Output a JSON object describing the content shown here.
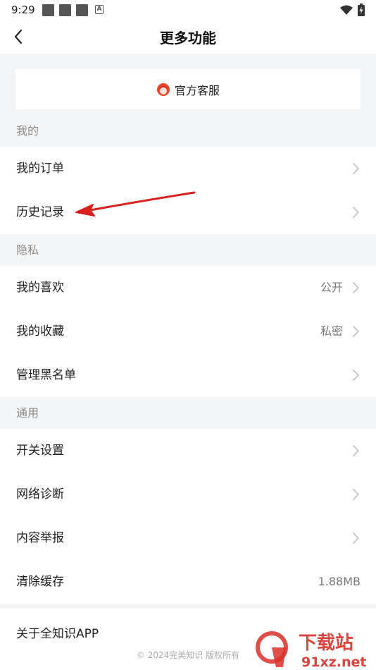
{
  "status_bar": {
    "time": "9:29",
    "badge": "A"
  },
  "header": {
    "title": "更多功能",
    "back_icon": "chevron-left-icon"
  },
  "service": {
    "label": "官方客服",
    "icon": "customer-service-avatar-icon",
    "accent": "#e8452c"
  },
  "sections": {
    "mine": {
      "title": "我的",
      "rows": [
        {
          "label": "我的订单",
          "value": ""
        },
        {
          "label": "历史记录",
          "value": ""
        }
      ]
    },
    "privacy": {
      "title": "隐私",
      "rows": [
        {
          "label": "我的喜欢",
          "value": "公开"
        },
        {
          "label": "我的收藏",
          "value": "私密"
        },
        {
          "label": "管理黑名单",
          "value": ""
        }
      ]
    },
    "general": {
      "title": "通用",
      "rows": [
        {
          "label": "开关设置",
          "value": ""
        },
        {
          "label": "网络诊断",
          "value": ""
        },
        {
          "label": "内容举报",
          "value": ""
        },
        {
          "label": "清除缓存",
          "value": "1.88MB"
        }
      ]
    }
  },
  "footer": {
    "about": "关于全知识APP",
    "copyright": "© 2024完美知识 版权所有"
  },
  "watermark": {
    "logo_text": "下载站",
    "url_text": "91xz.net",
    "color": "#d9302a"
  },
  "annotation_color": "#d8201f"
}
